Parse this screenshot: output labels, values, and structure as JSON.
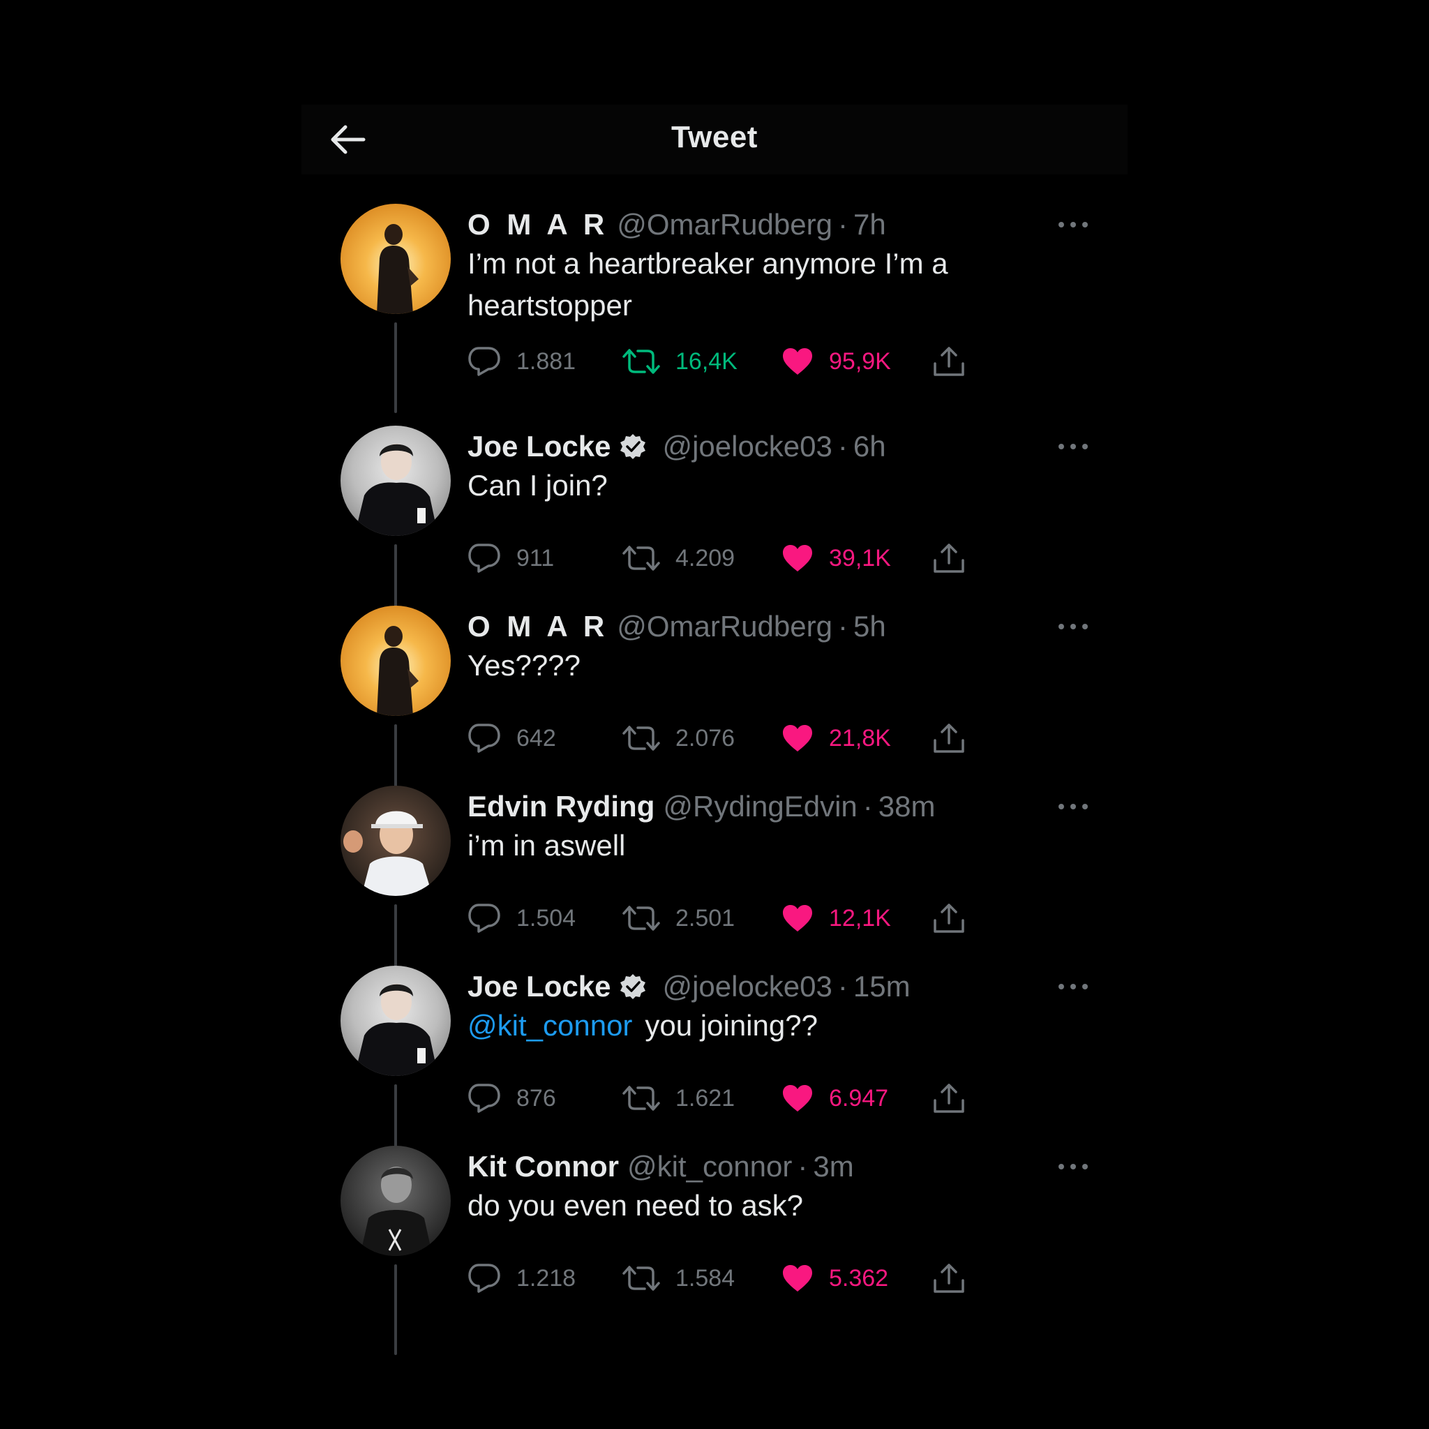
{
  "header": {
    "title": "Tweet",
    "back_icon": "arrow-left-icon"
  },
  "colors": {
    "background": "#000000",
    "retweet": "#00ba7c",
    "like": "#f91880",
    "link": "#1d9bf0",
    "muted": "#71767b"
  },
  "tweets": [
    {
      "name": "O M A R",
      "verified": false,
      "handle": "@OmarRudberg",
      "time": "7h",
      "mention": "",
      "text": "I’m not a heartbreaker anymore I’m a heartstopper",
      "replies": "1.881",
      "retweets": "16,4K",
      "likes": "95,9K",
      "retweeted": true
    },
    {
      "name": "Joe Locke",
      "verified": true,
      "handle": "@joelocke03",
      "time": "6h",
      "mention": "",
      "text": "Can I join?",
      "replies": "911",
      "retweets": "4.209",
      "likes": "39,1K",
      "retweeted": false
    },
    {
      "name": "O M A R",
      "verified": false,
      "handle": "@OmarRudberg",
      "time": "5h",
      "mention": "",
      "text": "Yes????",
      "replies": "642",
      "retweets": "2.076",
      "likes": "21,8K",
      "retweeted": false
    },
    {
      "name": "Edvin Ryding",
      "verified": false,
      "handle": "@RydingEdvin",
      "time": "38m",
      "mention": "",
      "text": "i’m in aswell",
      "replies": "1.504",
      "retweets": "2.501",
      "likes": "12,1K",
      "retweeted": false
    },
    {
      "name": "Joe Locke",
      "verified": true,
      "handle": "@joelocke03",
      "time": "15m",
      "mention": "@kit_connor",
      "text": "you joining??",
      "replies": "876",
      "retweets": "1.621",
      "likes": "6.947",
      "retweeted": false
    },
    {
      "name": "Kit Connor",
      "verified": false,
      "handle": "@kit_connor",
      "time": "3m",
      "mention": "",
      "text": "do you even need to ask?",
      "replies": "1.218",
      "retweets": "1.584",
      "likes": "5.362",
      "retweeted": false
    }
  ]
}
